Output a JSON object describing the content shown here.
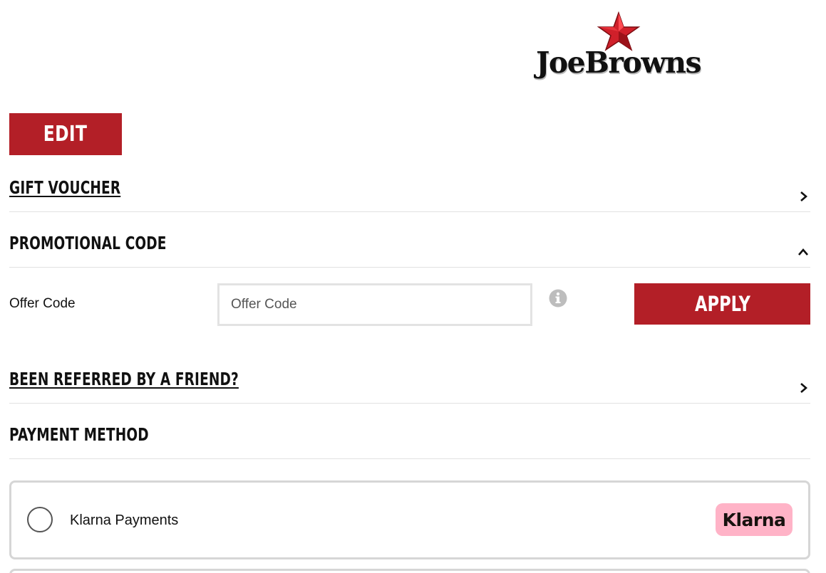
{
  "brand": {
    "logo_text": "JoeBrowns",
    "accent_color": "#b31f27",
    "klarna_pink": "#ffb3c7"
  },
  "edit_button": {
    "label": "EDIT"
  },
  "sections": {
    "gift_voucher": {
      "title": "GIFT VOUCHER",
      "state": "collapsed"
    },
    "promotional_code": {
      "title": "PROMOTIONAL CODE",
      "state": "expanded"
    },
    "referred": {
      "title": "BEEN REFERRED BY A FRIEND?",
      "state": "collapsed"
    },
    "payment_method": {
      "title": "PAYMENT METHOD"
    }
  },
  "promo": {
    "label": "Offer Code",
    "input_value": "",
    "input_placeholder": "Offer Code",
    "info_icon": "info-icon",
    "apply_label": "APPLY"
  },
  "payment_options": [
    {
      "label": "Klarna Payments",
      "badge": "Klarna",
      "selected": false
    }
  ]
}
